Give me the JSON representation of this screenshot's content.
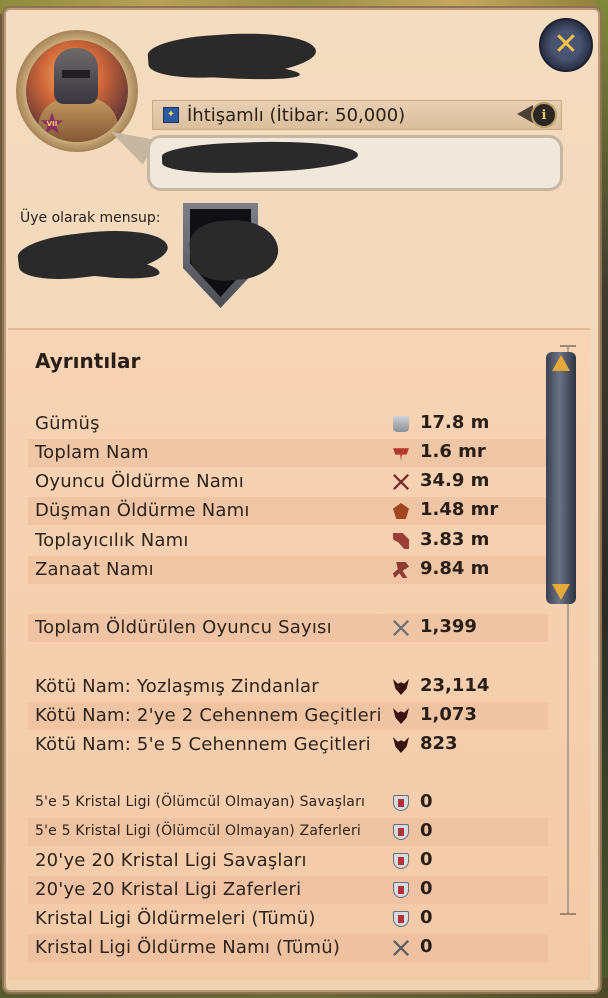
{
  "header": {
    "title": "İhtişamlı (İtibar: 50,000)",
    "member_label": "Üye olarak mensup:",
    "close_icon": "close-icon",
    "info_icon": "info-icon",
    "portrait_badge": "VII"
  },
  "details": {
    "title": "Ayrıntılar",
    "rows": [
      {
        "label": "Gümüş",
        "value": "17.8 m",
        "icon": "silver-icon"
      },
      {
        "label": "Toplam Nam",
        "value": "1.6 mr",
        "icon": "fame-icon"
      },
      {
        "label": "Oyuncu Öldürme Namı",
        "value": "34.9 m",
        "icon": "kill-fame-icon"
      },
      {
        "label": "Düşman Öldürme Namı",
        "value": "1.48 mr",
        "icon": "pve-fame-icon"
      },
      {
        "label": "Toplayıcılık Namı",
        "value": "3.83 m",
        "icon": "gathering-fame-icon"
      },
      {
        "label": "Zanaat Namı",
        "value": "9.84 m",
        "icon": "crafting-fame-icon"
      },
      {
        "label": "Toplam Öldürülen Oyuncu Sayısı",
        "value": "1,399",
        "icon": "crossed-swords-icon"
      },
      {
        "label": "Kötü Nam: Yozlaşmış Zindanlar",
        "value": "23,114",
        "icon": "infamy-icon"
      },
      {
        "label": "Kötü Nam: 2'ye 2 Cehennem Geçitleri",
        "value": "1,073",
        "icon": "infamy-icon"
      },
      {
        "label": "Kötü Nam: 5'e 5 Cehennem Geçitleri",
        "value": "823",
        "icon": "infamy-icon"
      },
      {
        "label": "5'e 5 Kristal Ligi (Ölümcül Olmayan) Savaşları",
        "value": "0",
        "icon": "crystal-league-icon"
      },
      {
        "label": "5'e 5 Kristal Ligi (Ölümcül Olmayan) Zaferleri",
        "value": "0",
        "icon": "crystal-league-icon"
      },
      {
        "label": "20'ye 20 Kristal Ligi Savaşları",
        "value": "0",
        "icon": "crystal-league-icon"
      },
      {
        "label": "20'ye 20 Kristal Ligi Zaferleri",
        "value": "0",
        "icon": "crystal-league-icon"
      },
      {
        "label": "Kristal Ligi Öldürmeleri (Tümü)",
        "value": "0",
        "icon": "crystal-league-icon"
      },
      {
        "label": "Kristal Ligi Öldürme Namı (Tümü)",
        "value": "0",
        "icon": "crystal-kill-fame-icon"
      }
    ]
  },
  "colors": {
    "panel_background": "#f3caa8",
    "accent_gold": "#e7a93a",
    "text_dark": "#2a1f18"
  }
}
